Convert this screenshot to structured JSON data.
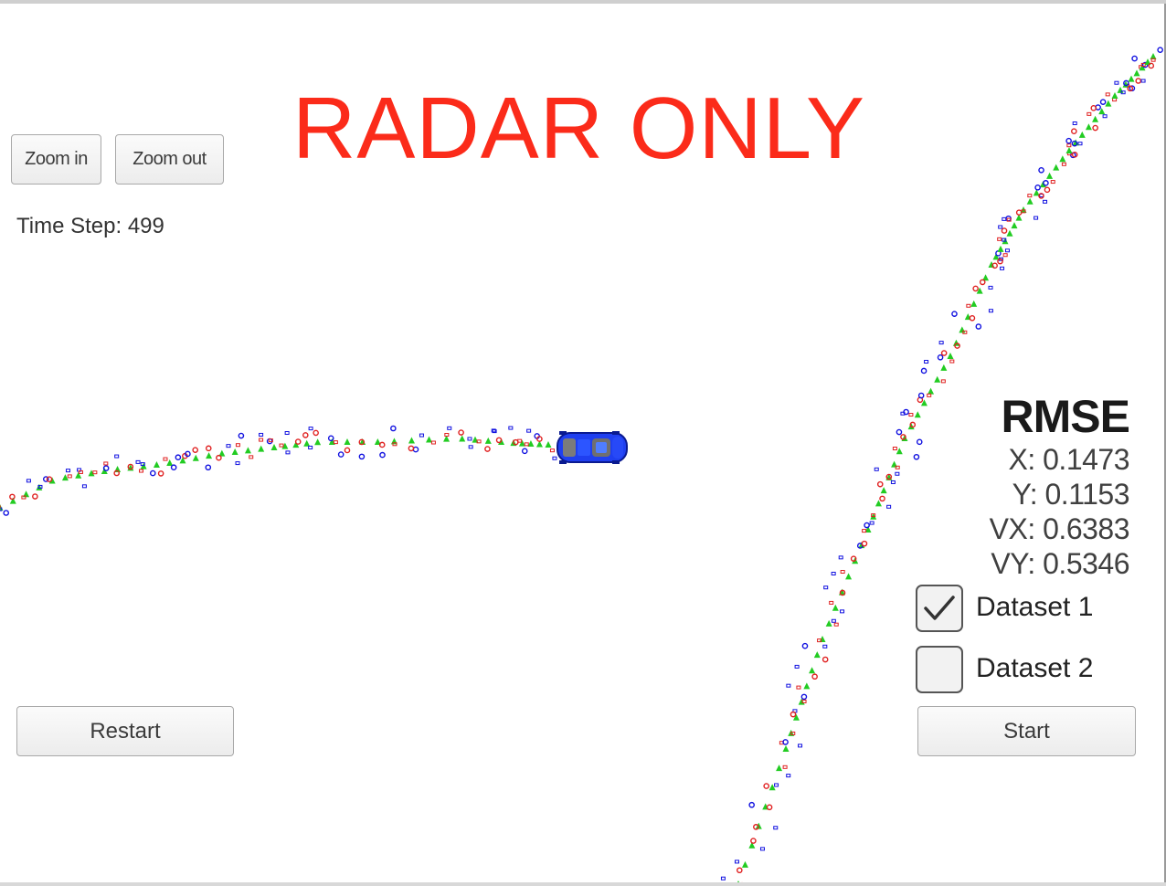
{
  "simulator": {
    "mode_title": "RADAR ONLY",
    "zoom_in_label": "Zoom in",
    "zoom_out_label": "Zoom out",
    "time_step_text": "Time Step: 499",
    "restart_label": "Restart",
    "start_label": "Start"
  },
  "rmse": {
    "title": "RMSE",
    "x": "X: 0.1473",
    "y": "Y: 0.1153",
    "vx": "VX: 0.6383",
    "vy": "VY: 0.5346"
  },
  "datasets": [
    {
      "label": "Dataset 1",
      "checked": true
    },
    {
      "label": "Dataset 2",
      "checked": false
    }
  ],
  "colors": {
    "title_red": "#fb2b1a",
    "radar_blue": "#1010e0",
    "estimate_red": "#e02020",
    "ground_truth_green": "#22cc22",
    "car_blue": "#1f3ff0"
  },
  "icons": {
    "car": "car-icon",
    "checkmark": "checkmark-icon"
  }
}
